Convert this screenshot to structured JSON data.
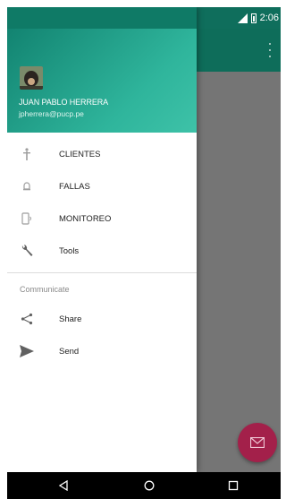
{
  "status_bar": {
    "time": "2:06"
  },
  "drawer": {
    "user_name": "JUAN PABLO HERRERA",
    "user_email": "jpherrera@pucp.pe",
    "items": [
      {
        "label": "CLIENTES",
        "icon": "person-icon"
      },
      {
        "label": "FALLAS",
        "icon": "alarm-bell-icon"
      },
      {
        "label": "MONITOREO",
        "icon": "phone-monitor-icon"
      },
      {
        "label": "Tools",
        "icon": "wrench-icon"
      }
    ],
    "section_title": "Communicate",
    "communicate_items": [
      {
        "label": "Share",
        "icon": "share-icon"
      },
      {
        "label": "Send",
        "icon": "send-icon"
      }
    ]
  },
  "colors": {
    "primary_dark": "#0f6e5c",
    "header_gradient": "#2fb59c",
    "fab": "#a3204a",
    "scrim": "#757575"
  },
  "nav": {
    "back": "back-icon",
    "home": "home-icon",
    "recents": "recents-icon"
  }
}
